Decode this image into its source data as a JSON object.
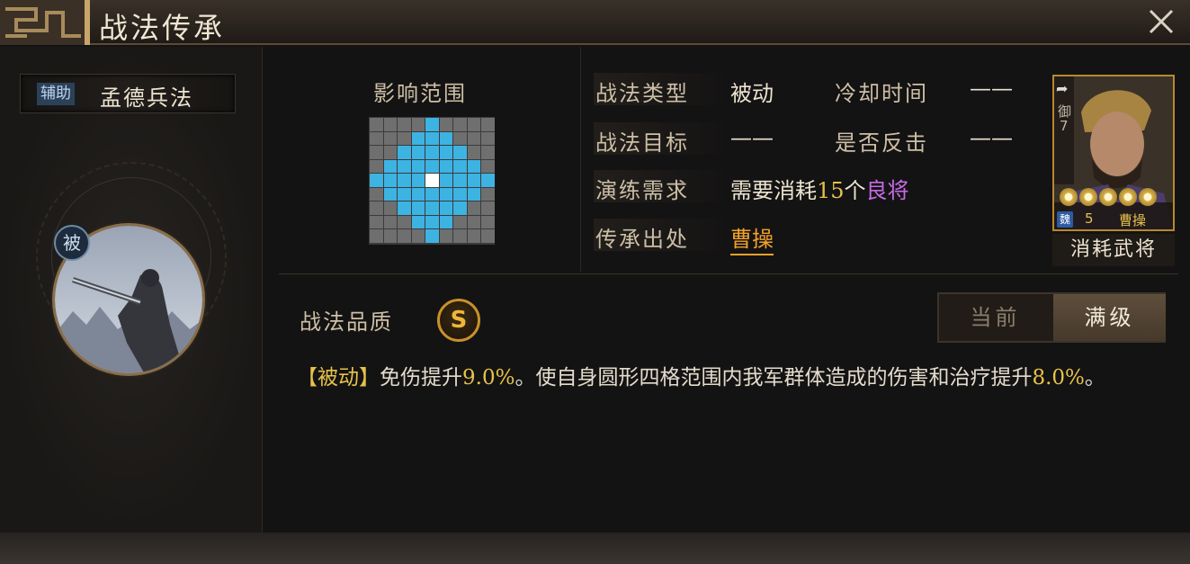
{
  "window": {
    "title": "战法传承"
  },
  "skill": {
    "type_badge": "辅助",
    "name": "孟德兵法",
    "passive_badge": "被"
  },
  "range": {
    "label": "影响范围",
    "rows": 9,
    "cols": 9,
    "highlighted_cells_by_row": [
      [
        4
      ],
      [
        3,
        4,
        5
      ],
      [
        2,
        3,
        4,
        5,
        6
      ],
      [
        1,
        2,
        3,
        4,
        5,
        6,
        7
      ],
      [
        0,
        1,
        2,
        3,
        4,
        5,
        6,
        7,
        8
      ],
      [
        1,
        2,
        3,
        4,
        5,
        6,
        7
      ],
      [
        2,
        3,
        4,
        5,
        6
      ],
      [
        3,
        4,
        5
      ],
      [
        4
      ]
    ],
    "center_cell": [
      4,
      4
    ],
    "colors": {
      "highlight": "#3db3e2",
      "empty": "#6f6f6f",
      "center": "#ffffff"
    }
  },
  "info": {
    "type_label": "战法类型",
    "type_value": "被动",
    "cooldown_label": "冷却时间",
    "cooldown_value": "——",
    "target_label": "战法目标",
    "target_value": "——",
    "counter_label": "是否反击",
    "counter_value": "——",
    "drill_label": "演练需求",
    "drill_prefix": "需要消耗",
    "drill_count": "15",
    "drill_unit": "个",
    "drill_item": "良将",
    "source_label": "传承出处",
    "source_value": "曹操"
  },
  "hero_card": {
    "class_glyph": "御",
    "cost": "7",
    "faction": "魏",
    "level": "5",
    "name": "曹操",
    "stars": 5,
    "caption": "消耗武将"
  },
  "quality": {
    "label": "战法品质",
    "grade": "S"
  },
  "level_toggle": {
    "current": "当前",
    "max": "满级",
    "selected": "max"
  },
  "description": {
    "tag": "【被动】",
    "part1": "免伤提升",
    "value1": "9.0%",
    "part2": "。使自身圆形四格范围内我军群体造成的伤害和治疗提升",
    "value2": "8.0%",
    "part3": "。"
  }
}
